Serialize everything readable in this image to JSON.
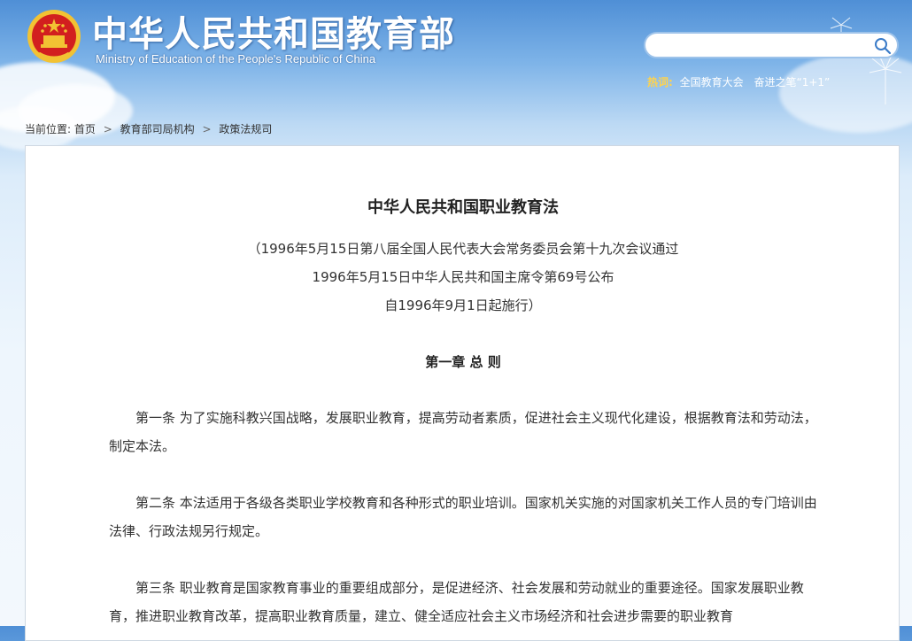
{
  "header": {
    "title": "中华人民共和国教育部",
    "subtitle": "Ministry of Education of the People's Republic of China"
  },
  "search": {
    "placeholder": "",
    "value": ""
  },
  "hot": {
    "label": "热词:",
    "items": [
      "全国教育大会",
      "奋进之笔“1+1”"
    ]
  },
  "breadcrumb": {
    "prefix": "当前位置:",
    "items": [
      "首页",
      "教育部司局机构",
      "政策法规司"
    ]
  },
  "document": {
    "title": "中华人民共和国职业教育法",
    "meta": [
      "（1996年5月15日第八届全国人民代表大会常务委员会第十九次会议通过",
      "1996年5月15日中华人民共和国主席令第69号公布",
      "自1996年9月1日起施行）"
    ],
    "chapter": "第一章 总 则",
    "articles": [
      "第一条 为了实施科教兴国战略，发展职业教育，提高劳动者素质，促进社会主义现代化建设，根据教育法和劳动法，制定本法。",
      "第二条 本法适用于各级各类职业学校教育和各种形式的职业培训。国家机关实施的对国家机关工作人员的专门培训由法律、行政法规另行规定。",
      "第三条 职业教育是国家教育事业的重要组成部分，是促进经济、社会发展和劳动就业的重要途径。国家发展职业教育，推进职业教育改革，提高职业教育质量，建立、健全适应社会主义市场经济和社会进步需要的职业教育"
    ]
  },
  "colors": {
    "brand_blue": "#4f8fd6",
    "hot_label": "#ffd34d",
    "emblem_red": "#d21f1f",
    "emblem_gold": "#f2c233"
  },
  "icons": {
    "emblem": "national-emblem-icon",
    "search": "search-icon",
    "breadcrumb_separator": "chevron-right-icon"
  }
}
